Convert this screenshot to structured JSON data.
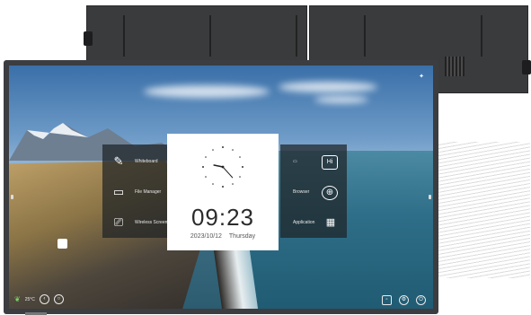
{
  "clock": {
    "time": "09:23",
    "date": "2023/10/12",
    "weekday": "Thursday",
    "hour": 9,
    "minute": 23
  },
  "left_panel": {
    "items": [
      {
        "label": "Whiteboard",
        "icon": "pen-signature-icon"
      },
      {
        "label": "File Manager",
        "icon": "folder-icon"
      },
      {
        "label": "Wireless Screen",
        "icon": "screen-cast-icon"
      }
    ]
  },
  "right_panel": {
    "items": [
      {
        "label": "Hi",
        "icon": "source-input-icon"
      },
      {
        "label": "Browser",
        "icon": "globe-icon"
      },
      {
        "label": "Application",
        "icon": "apps-grid-icon"
      }
    ]
  },
  "status_bar": {
    "temperature": "25°C",
    "icons": [
      "home-icon",
      "back-icon",
      "settings-icon"
    ]
  },
  "colors": {
    "bezel": "#3b3d40",
    "panel_bg": "rgba(30,34,38,0.72)",
    "clock_card": "#ffffff"
  }
}
